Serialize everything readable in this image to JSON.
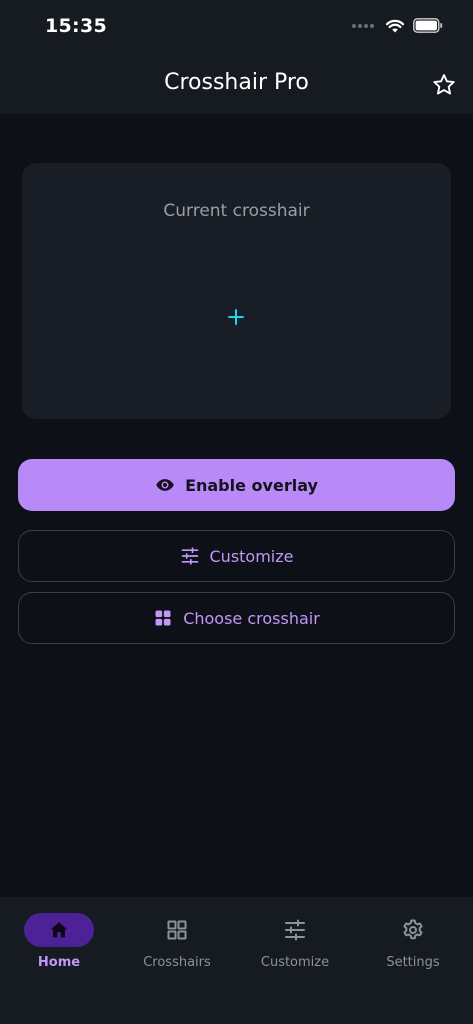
{
  "status_bar": {
    "time": "15:35"
  },
  "app_bar": {
    "title": "Crosshair Pro"
  },
  "preview": {
    "label": "Current crosshair",
    "crosshair_color": "#22d3ee"
  },
  "actions": {
    "enable_overlay": "Enable overlay",
    "customize": "Customize",
    "choose_crosshair": "Choose crosshair"
  },
  "bottom_nav": {
    "items": [
      {
        "label": "Home",
        "icon": "home-icon",
        "active": true
      },
      {
        "label": "Crosshairs",
        "icon": "grid-icon",
        "active": false
      },
      {
        "label": "Customize",
        "icon": "sliders-icon",
        "active": false
      },
      {
        "label": "Settings",
        "icon": "gear-icon",
        "active": false
      }
    ]
  },
  "colors": {
    "accent": "#b88af7",
    "accent_text": "#c197f8",
    "background": "#0d1016",
    "surface": "#161a21",
    "card": "#191d25",
    "nav_active_pill": "#4d2296"
  }
}
